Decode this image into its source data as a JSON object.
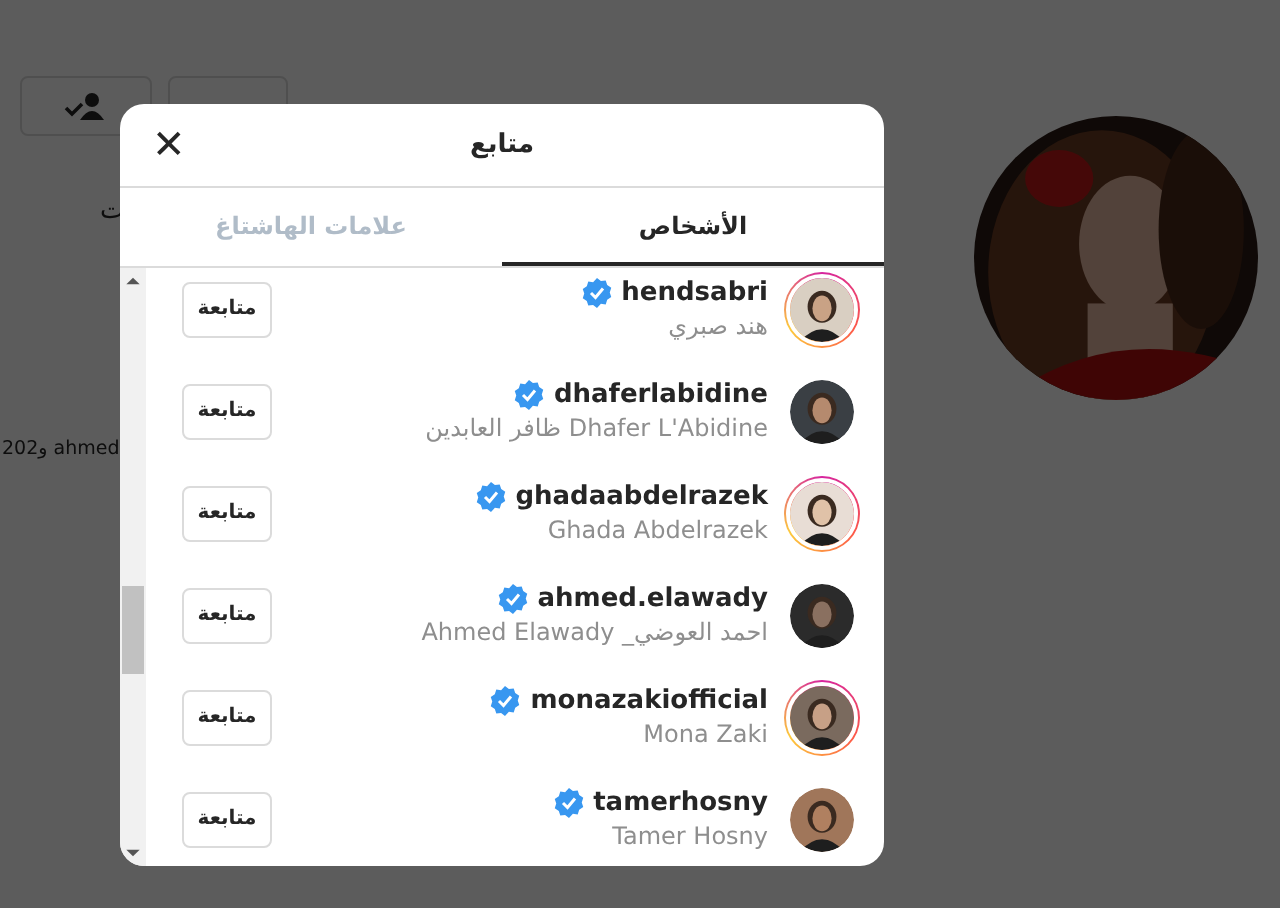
{
  "background": {
    "texts": [
      "ت",
      "202و ahmed"
    ]
  },
  "dialog": {
    "title": "متابع",
    "close": "✕"
  },
  "tabs": [
    {
      "label": "الأشخاص",
      "selected": true
    },
    {
      "label": "علامات الهاشتاغ",
      "selected": false
    }
  ],
  "accounts": [
    {
      "username": "hendsabri",
      "full_name": "هند صبري",
      "verified": true,
      "story_ring": true,
      "button": "متابعة"
    },
    {
      "username": "dhaferlabidine",
      "full_name": "Dhafer L'Abidine ظافر العابدين",
      "verified": true,
      "story_ring": false,
      "button": "متابعة"
    },
    {
      "username": "ghadaabdelrazek",
      "full_name": "Ghada Abdelrazek",
      "verified": true,
      "story_ring": true,
      "button": "متابعة"
    },
    {
      "username": "ahmed.elawady",
      "full_name": "احمد العوضي_ Ahmed Elawady",
      "verified": true,
      "story_ring": false,
      "button": "متابعة"
    },
    {
      "username": "monazakiofficial",
      "full_name": "Mona Zaki",
      "verified": true,
      "story_ring": true,
      "button": "متابعة"
    },
    {
      "username": "tamerhosny",
      "full_name": "Tamer Hosny",
      "verified": true,
      "story_ring": false,
      "button": "متابعة"
    }
  ]
}
